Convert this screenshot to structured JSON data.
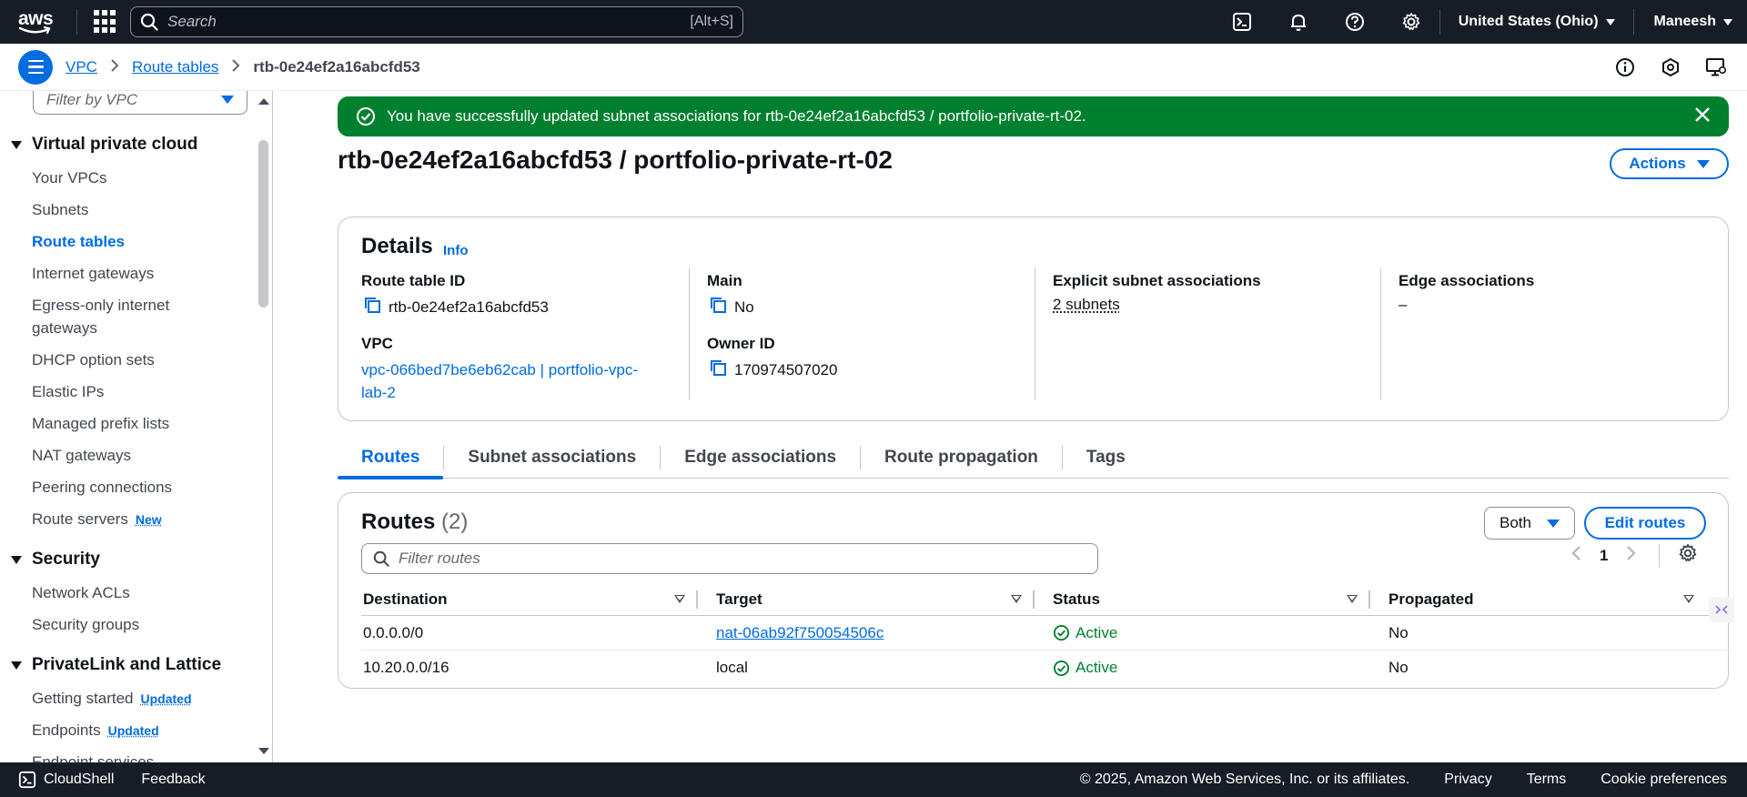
{
  "topnav": {
    "logo_text": "aws",
    "search_placeholder": "Search",
    "search_shortcut": "[Alt+S]",
    "region": "United States (Ohio)",
    "user": "Maneesh",
    "icons": [
      "cloudshell-icon",
      "bell-icon",
      "help-icon",
      "gear-icon"
    ]
  },
  "breadcrumb": {
    "items": [
      "VPC",
      "Route tables"
    ],
    "current": "rtb-0e24ef2a16abcfd53"
  },
  "sidebar": {
    "filter_placeholder": "Filter by VPC",
    "sections": [
      {
        "title": "Virtual private cloud",
        "items": [
          {
            "label": "Your VPCs"
          },
          {
            "label": "Subnets"
          },
          {
            "label": "Route tables",
            "active": true
          },
          {
            "label": "Internet gateways"
          },
          {
            "label": "Egress-only internet gateways"
          },
          {
            "label": "DHCP option sets"
          },
          {
            "label": "Elastic IPs"
          },
          {
            "label": "Managed prefix lists"
          },
          {
            "label": "NAT gateways"
          },
          {
            "label": "Peering connections"
          },
          {
            "label": "Route servers",
            "badge": "New"
          }
        ]
      },
      {
        "title": "Security",
        "items": [
          {
            "label": "Network ACLs"
          },
          {
            "label": "Security groups"
          }
        ]
      },
      {
        "title": "PrivateLink and Lattice",
        "items": [
          {
            "label": "Getting started",
            "badge": "Updated"
          },
          {
            "label": "Endpoints",
            "badge": "Updated"
          },
          {
            "label": "Endpoint services"
          }
        ]
      }
    ]
  },
  "flash": {
    "message": "You have successfully updated subnet associations for rtb-0e24ef2a16abcfd53 / portfolio-private-rt-02."
  },
  "page": {
    "title": "rtb-0e24ef2a16abcfd53 / portfolio-private-rt-02",
    "actions_label": "Actions"
  },
  "details": {
    "heading": "Details",
    "info_label": "Info",
    "route_table_id_label": "Route table ID",
    "route_table_id": "rtb-0e24ef2a16abcfd53",
    "vpc_label": "VPC",
    "vpc_value": "vpc-066bed7be6eb62cab | portfolio-vpc-lab-2",
    "main_label": "Main",
    "main_value": "No",
    "owner_label": "Owner ID",
    "owner_value": "170974507020",
    "explicit_label": "Explicit subnet associations",
    "explicit_value": "2 subnets",
    "edge_label": "Edge associations",
    "edge_value": "–"
  },
  "tabs": [
    "Routes",
    "Subnet associations",
    "Edge associations",
    "Route propagation",
    "Tags"
  ],
  "routes": {
    "heading": "Routes",
    "count": "(2)",
    "filter_select": "Both",
    "edit_label": "Edit routes",
    "filter_placeholder": "Filter routes",
    "page": "1",
    "columns": [
      "Destination",
      "Target",
      "Status",
      "Propagated"
    ],
    "rows": [
      {
        "destination": "0.0.0.0/0",
        "target": "nat-06ab92f750054506c",
        "target_link": true,
        "status": "Active",
        "propagated": "No"
      },
      {
        "destination": "10.20.0.0/16",
        "target": "local",
        "target_link": false,
        "status": "Active",
        "propagated": "No"
      }
    ]
  },
  "footer": {
    "cloudshell": "CloudShell",
    "feedback": "Feedback",
    "copyright": "© 2025, Amazon Web Services, Inc. or its affiliates.",
    "privacy": "Privacy",
    "terms": "Terms",
    "cookies": "Cookie preferences"
  },
  "colors": {
    "nav_bg": "#161d26",
    "link_blue": "#006ce0",
    "success_green": "#00802f",
    "aws_orange": "#ff9900"
  }
}
